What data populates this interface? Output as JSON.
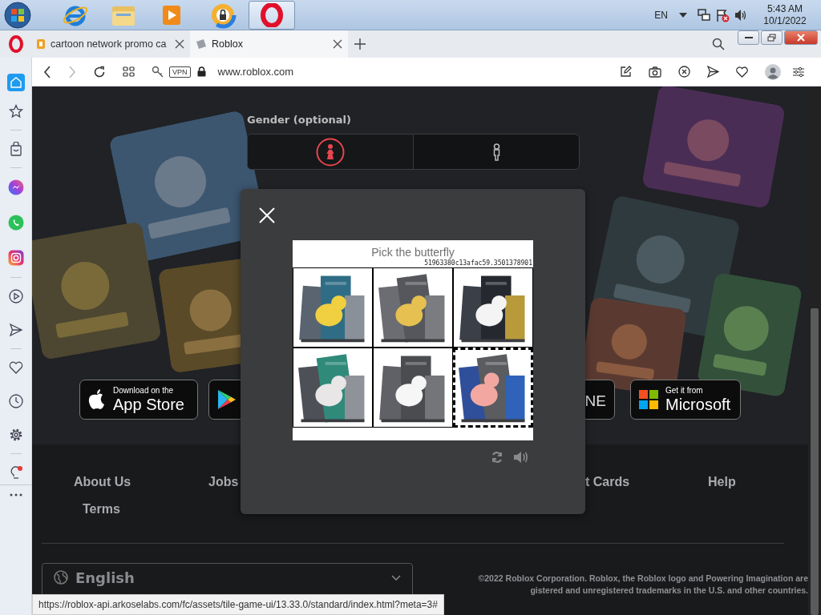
{
  "taskbar": {
    "language": "EN",
    "time": "5:43 AM",
    "date": "10/1/2022"
  },
  "browser": {
    "tabs": [
      {
        "title": "cartoon network promo ca",
        "selected": false
      },
      {
        "title": "Roblox",
        "selected": true
      }
    ],
    "vpn": "VPN",
    "address": "www.roblox.com",
    "status_url": "https://roblox-api.arkoselabs.com/fc/assets/tile-game-ui/13.33.0/standard/index.html?meta=3#"
  },
  "signup": {
    "gender_label": "Gender (optional)",
    "gender_options": [
      {
        "kind": "female",
        "selected": true
      },
      {
        "kind": "male",
        "selected": false
      }
    ]
  },
  "store_badges": [
    {
      "kind": "apple",
      "small": "Download on the",
      "big": "App Store"
    },
    {
      "kind": "google"
    },
    {
      "kind": "text",
      "big": "NE"
    },
    {
      "kind": "microsoft",
      "small": "Get it from",
      "big": "Microsoft"
    }
  ],
  "footer": {
    "link_rows": [
      {
        "links": [
          "About Us",
          "Jobs",
          "t Cards",
          "Help"
        ]
      },
      {
        "links": [
          "Terms"
        ]
      }
    ],
    "language": "English",
    "copyright": [
      "©2022 Roblox Corporation. Roblox, the Roblox logo and Powering Imagination are",
      "gistered and unregistered trademarks in the U.S. and other countries."
    ]
  },
  "captcha": {
    "prompt": "Pick the butterfly",
    "session_code": "51963380c13afac59.3501378901",
    "tiles": [
      {
        "kind": "picture",
        "selected": false
      },
      {
        "kind": "picture",
        "selected": false
      },
      {
        "kind": "picture",
        "selected": false
      },
      {
        "kind": "picture",
        "selected": false
      },
      {
        "kind": "picture",
        "selected": false
      },
      {
        "kind": "picture",
        "selected": true
      }
    ]
  }
}
